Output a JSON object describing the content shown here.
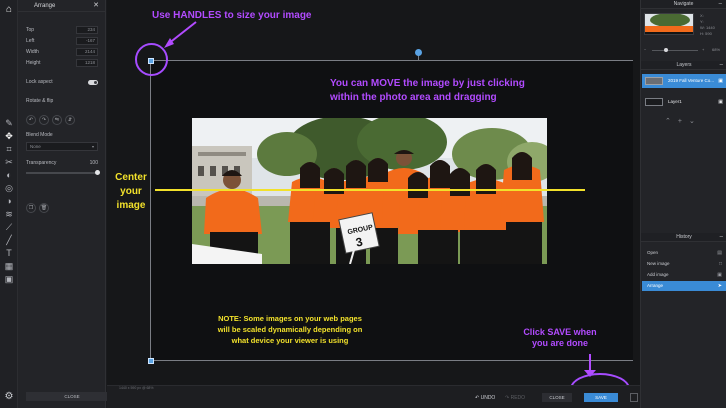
{
  "tools": {
    "items": [
      "logo",
      "crop",
      "move",
      "transform",
      "cut",
      "adjust",
      "filter",
      "effect",
      "liquify",
      "brush",
      "pen",
      "text",
      "frame",
      "image"
    ]
  },
  "arrange": {
    "title": "Arrange",
    "top_label": "Top",
    "top_value": "234",
    "left_label": "Left",
    "left_value": "-167",
    "width_label": "Width",
    "width_value": "2144",
    "height_label": "Height",
    "height_value": "1218",
    "lock_label": "Lock aspect",
    "rotate_label": "Rotate & flip",
    "blend_label": "Blend Mode",
    "blend_value": "None",
    "transparency_label": "Transparency",
    "transparency_value": "100",
    "close_label": "CLOSE"
  },
  "canvas": {
    "annotations": {
      "handles": "Use HANDLES to size your image",
      "move_line1": "You can MOVE the image by just clicking",
      "move_line2": "within the photo area and dragging",
      "center_line1": "Center",
      "center_line2": "your",
      "center_line3": "image",
      "note_line1": "NOTE: Some images on your web pages",
      "note_line2": "will be scaled dynamically depending on",
      "note_line3": "what device your viewer is using",
      "save_line1": "Click SAVE when",
      "save_line2": "you are done"
    },
    "photo_sign": "GROUP 3",
    "photo_sign_top": "GROUP",
    "photo_sign_num": "3"
  },
  "statusbar": {
    "zoom_info": "1440 x 590 px @ 68%",
    "undo": "UNDO",
    "redo": "REDO",
    "close": "CLOSE",
    "save": "SAVE"
  },
  "navigate": {
    "title": "Navigate",
    "x_label": "X:",
    "y_label": "Y:",
    "w_label": "W:",
    "w_value": "1440",
    "h_label": "H:",
    "h_value": "590",
    "zoom_value": "68%"
  },
  "layers": {
    "title": "Layers",
    "items": [
      {
        "label": "2019 Fall Venture Co..."
      },
      {
        "label": "Layer1"
      }
    ]
  },
  "history": {
    "title": "History",
    "items": [
      {
        "label": "Open"
      },
      {
        "label": "New image"
      },
      {
        "label": "Add image"
      },
      {
        "label": "Arrange"
      }
    ]
  },
  "colors": {
    "accent": "#3a8bd6",
    "annotation_purple": "#b24bff",
    "annotation_yellow": "#f2e12b",
    "shirt_orange": "#f26a1b"
  }
}
